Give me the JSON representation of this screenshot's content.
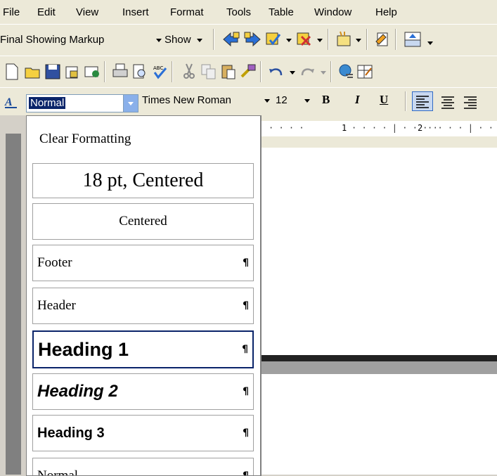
{
  "menubar": [
    "File",
    "Edit",
    "View",
    "Insert",
    "Format",
    "Tools",
    "Table",
    "Window",
    "Help"
  ],
  "reviewing": {
    "display": "Final Showing Markup",
    "show": "Show"
  },
  "formatting": {
    "style": "Normal",
    "font": "Times New Roman",
    "size": "12",
    "bold": "B",
    "italic": "I",
    "underline": "U"
  },
  "ruler": {
    "mark1": "1",
    "mark2": "2"
  },
  "style_menu": {
    "clear": "Clear Formatting",
    "items": [
      {
        "label": "18 pt, Centered"
      },
      {
        "label": "Centered"
      },
      {
        "label": "Footer",
        "mark": "¶"
      },
      {
        "label": "Header",
        "mark": "¶"
      },
      {
        "label": "Heading 1",
        "mark": "¶"
      },
      {
        "label": "Heading 2",
        "mark": "¶"
      },
      {
        "label": "Heading 3",
        "mark": "¶"
      },
      {
        "label": "Normal",
        "mark": "¶"
      }
    ]
  },
  "colors": {
    "selection": "#0a246a",
    "toolbar": "#ece9d8",
    "highlight_border": "#0a246a"
  }
}
